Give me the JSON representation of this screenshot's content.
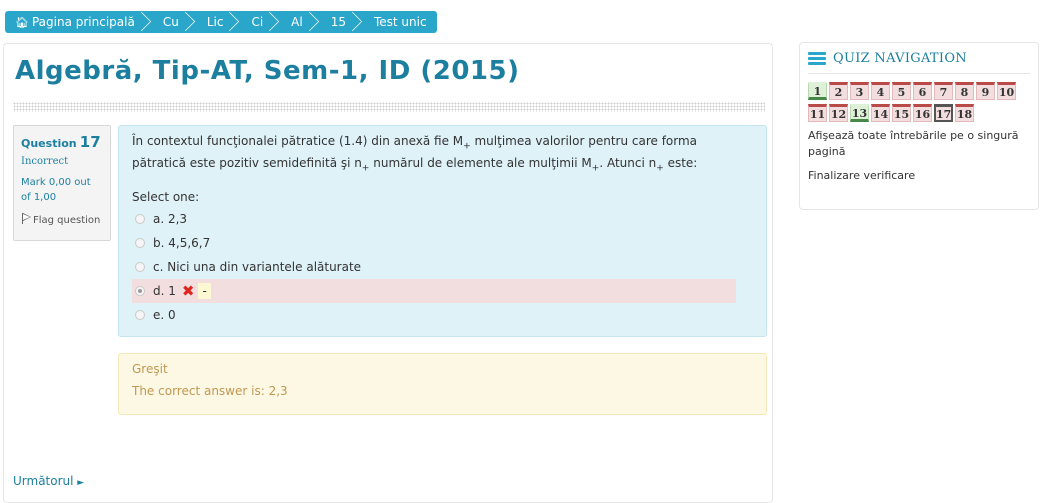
{
  "breadcrumb": [
    {
      "label": "Pagina principală",
      "icon": "home-icon"
    },
    {
      "label": "Cu"
    },
    {
      "label": "Lic"
    },
    {
      "label": "Ci"
    },
    {
      "label": "Al"
    },
    {
      "label": "15"
    },
    {
      "label": "Test unic"
    }
  ],
  "page": {
    "title": "Algebră, Tip-AT, Sem-1, ID (2015)"
  },
  "question": {
    "label": "Question",
    "number": "17",
    "state": "Incorrect",
    "grade": "Mark 0,00 out of 1,00",
    "flag_label": "Flag question",
    "text_parts": {
      "p1": "În contextul funcţionalei pătratice (1.4) din anexă fie M",
      "p2": " mulţimea valorilor pentru care forma pătratică este pozitiv semidefinită şi n",
      "p3": " numărul de elemente ale mulţimii M",
      "p4": ". Atunci n",
      "p5": " este:",
      "sub": "+"
    },
    "prompt": "Select one:",
    "answers": [
      {
        "label": "a. 2,3",
        "selected": false
      },
      {
        "label": "b. 4,5,6,7",
        "selected": false
      },
      {
        "label": "c. Nici una din variantele alăturate",
        "selected": false
      },
      {
        "label": "d. 1",
        "selected": true,
        "feedback": "-"
      },
      {
        "label": "e. 0",
        "selected": false
      }
    ]
  },
  "outcome": {
    "feedback": "Greşit",
    "right_answer": "The correct answer is: 2,3"
  },
  "nav": {
    "next_label": "Următorul",
    "quiz_title": "QUIZ NAVIGATION",
    "buttons": [
      {
        "n": "1",
        "state": "correct"
      },
      {
        "n": "2",
        "state": "incorrect"
      },
      {
        "n": "3",
        "state": "incorrect"
      },
      {
        "n": "4",
        "state": "incorrect"
      },
      {
        "n": "5",
        "state": "incorrect"
      },
      {
        "n": "6",
        "state": "incorrect"
      },
      {
        "n": "7",
        "state": "incorrect"
      },
      {
        "n": "8",
        "state": "incorrect"
      },
      {
        "n": "9",
        "state": "incorrect"
      },
      {
        "n": "10",
        "state": "incorrect"
      },
      {
        "n": "11",
        "state": "incorrect"
      },
      {
        "n": "12",
        "state": "incorrect"
      },
      {
        "n": "13",
        "state": "correct"
      },
      {
        "n": "14",
        "state": "incorrect"
      },
      {
        "n": "15",
        "state": "incorrect"
      },
      {
        "n": "16",
        "state": "incorrect"
      },
      {
        "n": "17",
        "state": "current"
      },
      {
        "n": "18",
        "state": "incorrect"
      }
    ],
    "show_all_label": "Afişează toate întrebările pe o singură pagină",
    "finish_label": "Finalizare verificare"
  },
  "colors": {
    "accent": "#2ba6cb",
    "incorrect_bg": "#f2dede",
    "correct_bg": "#dff0d8",
    "outcome_bg": "#fcf8e3"
  }
}
